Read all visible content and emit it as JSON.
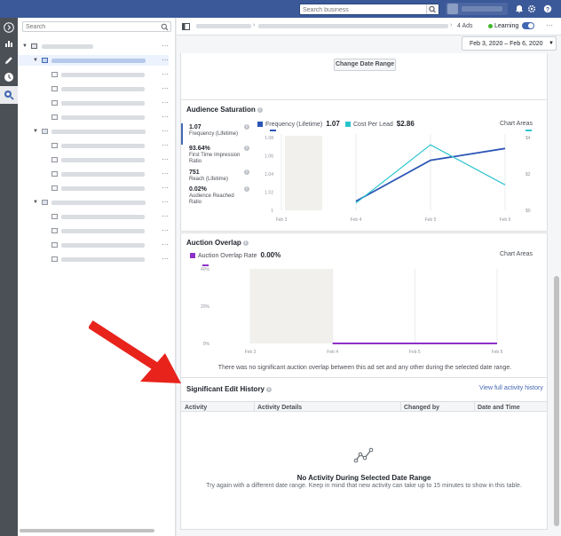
{
  "topbar": {
    "search_placeholder": "Search business",
    "icons": [
      "search-icon",
      "bell-icon",
      "gear-icon",
      "help-icon"
    ]
  },
  "leftnav": {
    "icons": [
      "expand-icon",
      "chart-icon",
      "edit-icon",
      "history-icon",
      "search-icon"
    ]
  },
  "tree": {
    "search_placeholder": "Search"
  },
  "subhead": {
    "ad_count": "4 Ads",
    "learning_label": "Learning"
  },
  "date_range": "Feb 3, 2020 – Feb 6, 2020",
  "change_date_range_label": "Change Date Range",
  "audience_saturation": {
    "title": "Audience Saturation",
    "metrics": [
      {
        "value": "1.07",
        "label": "Frequency (Lifetime)"
      },
      {
        "value": "93.64%",
        "label": "First Time Impression Ratio"
      },
      {
        "value": "751",
        "label": "Reach (Lifetime)"
      },
      {
        "value": "0.02%",
        "label": "Audience Reached Ratio"
      }
    ],
    "legend": [
      {
        "name": "Frequency (Lifetime)",
        "value": "1.07",
        "color": "#2c56b6"
      },
      {
        "name": "Cost Per Lead",
        "value": "$2.86",
        "color": "#2bc4cc"
      }
    ],
    "chart_areas_label": "Chart Areas"
  },
  "auction_overlap": {
    "title": "Auction Overlap",
    "legend": {
      "name": "Auction Overlap Rate",
      "value": "0.00%",
      "color": "#8e30c8"
    },
    "chart_areas_label": "Chart Areas",
    "note": "There was no significant auction overlap between this ad set and any other during the selected date range."
  },
  "edit_history": {
    "title": "Significant Edit History",
    "link": "View full activity history",
    "columns": [
      "Activity",
      "Activity Details",
      "Changed by",
      "Date and Time"
    ],
    "empty_title": "No Activity During Selected Date Range",
    "empty_desc": "Try again with a different date range. Keep in mind that new activity can take up to 15 minutes to show in this table."
  },
  "chart_data": [
    {
      "type": "line",
      "categories": [
        "Feb 3",
        "Feb 4",
        "Feb 5",
        "Feb 6"
      ],
      "series": [
        {
          "name": "Frequency (Lifetime)",
          "axis": "left",
          "values": [
            null,
            1.01,
            1.055,
            1.068
          ]
        },
        {
          "name": "Cost Per Lead",
          "axis": "right",
          "values": [
            null,
            0.4,
            3.6,
            1.4
          ]
        }
      ],
      "y_left": {
        "ticks": [
          "1",
          "1.02",
          "1.04",
          "1.06",
          "1.08"
        ],
        "ylim": [
          1,
          1.08
        ]
      },
      "y_right": {
        "ticks": [
          "$0",
          "$2",
          "$4"
        ],
        "ylim": [
          0,
          4
        ]
      },
      "shaded_category": "Feb 3",
      "legend_position": "top-left"
    },
    {
      "type": "line",
      "categories": [
        "Feb 3",
        "Feb 4",
        "Feb 5",
        "Feb 6"
      ],
      "series": [
        {
          "name": "Auction Overlap Rate",
          "values": [
            null,
            0,
            0,
            0
          ]
        }
      ],
      "y": {
        "ticks": [
          "0%",
          "20%",
          "40%"
        ],
        "ylim": [
          0,
          40
        ]
      },
      "shaded_category": "Feb 3",
      "legend_position": "top-left"
    }
  ]
}
